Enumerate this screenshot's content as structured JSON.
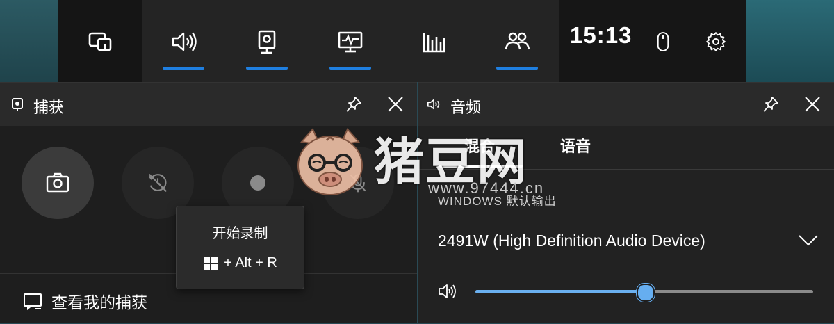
{
  "topbar": {
    "buttons": [
      {
        "name": "widget-menu",
        "icon": "widget-menu-icon",
        "active": false
      },
      {
        "name": "audio",
        "icon": "speaker-icon",
        "active": true
      },
      {
        "name": "capture",
        "icon": "webcam-icon",
        "active": true
      },
      {
        "name": "performance",
        "icon": "monitor-chart-icon",
        "active": true
      },
      {
        "name": "resources",
        "icon": "bar-chart-icon",
        "active": false
      },
      {
        "name": "social",
        "icon": "people-icon",
        "active": true
      }
    ],
    "clock": "15:13",
    "accent": "#1f7fe0"
  },
  "capture_panel": {
    "title": "捕获",
    "footer_label": "查看我的捕获",
    "tooltip": {
      "title": "开始录制",
      "shortcut": "+ Alt + R"
    }
  },
  "audio_panel": {
    "title": "音频",
    "tabs": [
      {
        "label": "混合",
        "active": true
      },
      {
        "label": "语音",
        "active": false
      }
    ],
    "device_label": "WINDOWS 默认输出",
    "device_value": "2491W (High Definition Audio Device)",
    "volume": 0.5
  },
  "watermark": {
    "text": "猪豆网",
    "sub": "www.97444.cn"
  }
}
